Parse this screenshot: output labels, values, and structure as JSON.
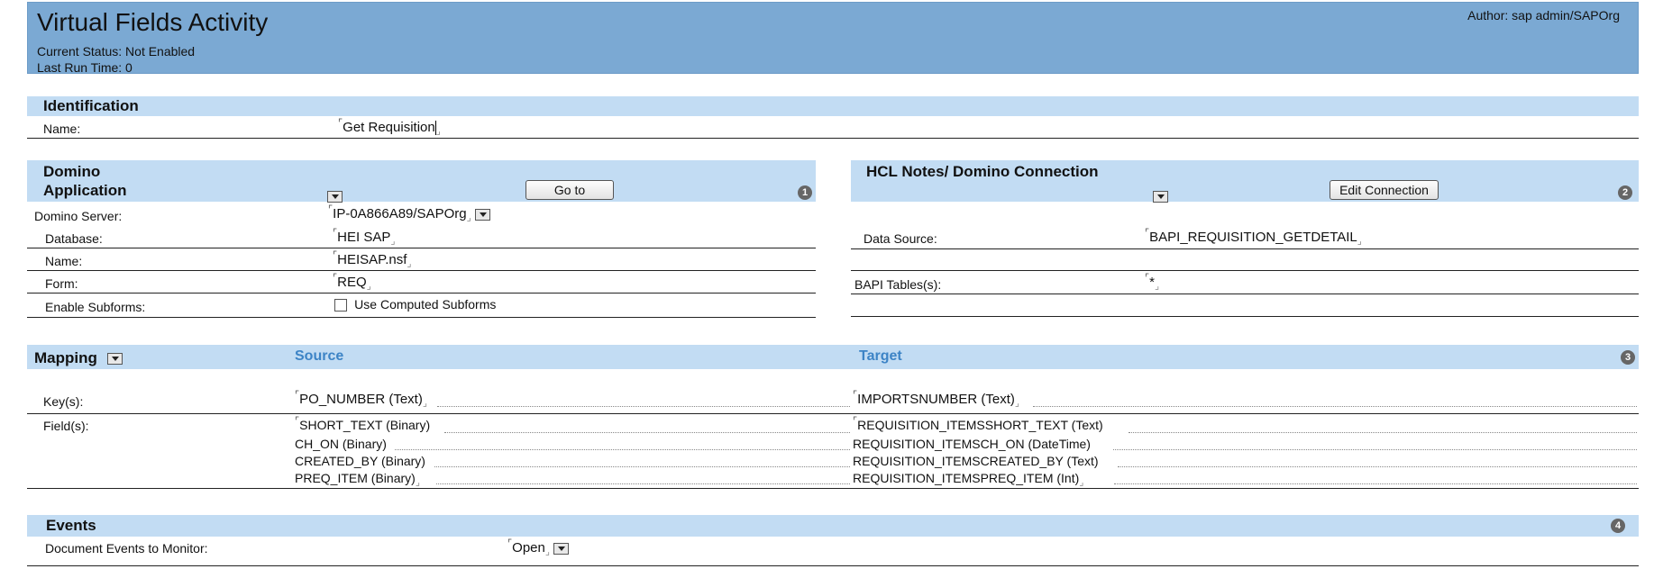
{
  "header": {
    "title": "Virtual Fields Activity",
    "status": "Current Status: Not Enabled",
    "last_run": "Last Run Time:  0",
    "author": "Author: sap admin/SAPOrg"
  },
  "identification": {
    "section_label": "Identification",
    "name_label": "Name:",
    "name_value": "Get  Requisition"
  },
  "domino": {
    "section_label_line1": "Domino",
    "section_label_line2": "Application",
    "goto_label": "Go to",
    "step": "1",
    "server_label": "Domino Server:",
    "server_value": "IP-0A866A89/SAPOrg",
    "database_label": "Database:",
    "database_value": "HEI SAP",
    "name_label": "Name:",
    "name_value": "HEISAP.nsf",
    "form_label": "Form:",
    "form_value": "REQ",
    "subforms_label": "Enable Subforms:",
    "subforms_checkbox_label": "Use Computed Subforms",
    "subforms_checked": false
  },
  "connection": {
    "section_label": "HCL Notes/ Domino Connection",
    "edit_label": "Edit Connection",
    "step": "2",
    "datasource_label": "Data Source:",
    "datasource_value": "BAPI_REQUISITION_GETDETAIL",
    "tables_label": "BAPI Tables(s):",
    "tables_value": "*"
  },
  "mapping": {
    "section_label": "Mapping",
    "source_header": "Source",
    "target_header": "Target",
    "step": "3",
    "keys_label": "Key(s):",
    "key_source": "PO_NUMBER (Text)",
    "key_target": "IMPORTSNUMBER (Text)",
    "fields_label": "Field(s):",
    "field_sources": [
      "SHORT_TEXT (Binary)",
      "CH_ON (Binary)",
      "CREATED_BY (Binary)",
      "PREQ_ITEM (Binary)"
    ],
    "field_targets": [
      "REQUISITION_ITEMSSHORT_TEXT (Text)",
      "REQUISITION_ITEMSCH_ON (DateTime)",
      "REQUISITION_ITEMSCREATED_BY (Text)",
      "REQUISITION_ITEMSPREQ_ITEM (Int)"
    ]
  },
  "events": {
    "section_label": "Events",
    "step": "4",
    "monitor_label": "Document Events to Monitor:",
    "monitor_value": "Open"
  }
}
